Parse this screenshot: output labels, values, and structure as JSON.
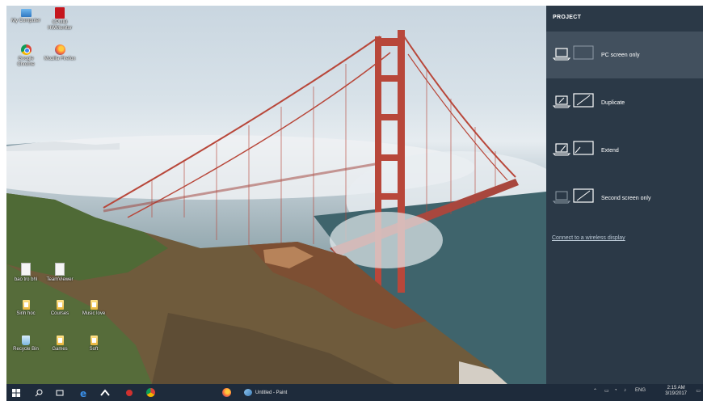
{
  "desktop": {
    "icons": [
      {
        "label": "My Computer",
        "icon": "computer-icon"
      },
      {
        "label": "CPUID HWMonitor",
        "icon": "hwmonitor-icon"
      },
      {
        "label": "Google Chrome",
        "icon": "chrome-icon"
      },
      {
        "label": "Mozilla Firefox",
        "icon": "firefox-icon"
      },
      {
        "label": "bao tro bhl",
        "icon": "document-icon"
      },
      {
        "label": "TeamViewer",
        "icon": "document-icon"
      },
      {
        "label": "Sinh hoc",
        "icon": "folder-icon"
      },
      {
        "label": "Courses",
        "icon": "folder-icon"
      },
      {
        "label": "Music love",
        "icon": "folder-icon"
      },
      {
        "label": "Recycle Bin",
        "icon": "recycle-bin-icon"
      },
      {
        "label": "Games",
        "icon": "folder-icon"
      },
      {
        "label": "Soft",
        "icon": "folder-icon"
      }
    ]
  },
  "project_panel": {
    "title": "PROJECT",
    "options": [
      {
        "label": "PC screen only",
        "icon": "pc-screen-only-icon",
        "selected": true
      },
      {
        "label": "Duplicate",
        "icon": "duplicate-icon",
        "selected": false
      },
      {
        "label": "Extend",
        "icon": "extend-icon",
        "selected": false
      },
      {
        "label": "Second screen only",
        "icon": "second-screen-only-icon",
        "selected": false
      }
    ],
    "wireless_link": "Connect to a wireless display"
  },
  "taskbar": {
    "pinned": [
      "start-icon",
      "search-icon",
      "task-view-icon",
      "edge-icon",
      "steam-icon",
      "app-icon",
      "chrome-icon",
      "firefox-icon"
    ],
    "active_window": "Untitled - Paint",
    "tray": {
      "language": "ENG",
      "time": "2:15 AM",
      "date": "3/19/2017"
    }
  },
  "colors": {
    "panel_bg": "#2b3947",
    "panel_selected": "#42505e",
    "taskbar_bg": "#1e2b3b",
    "bridge_red": "#b8473a"
  }
}
